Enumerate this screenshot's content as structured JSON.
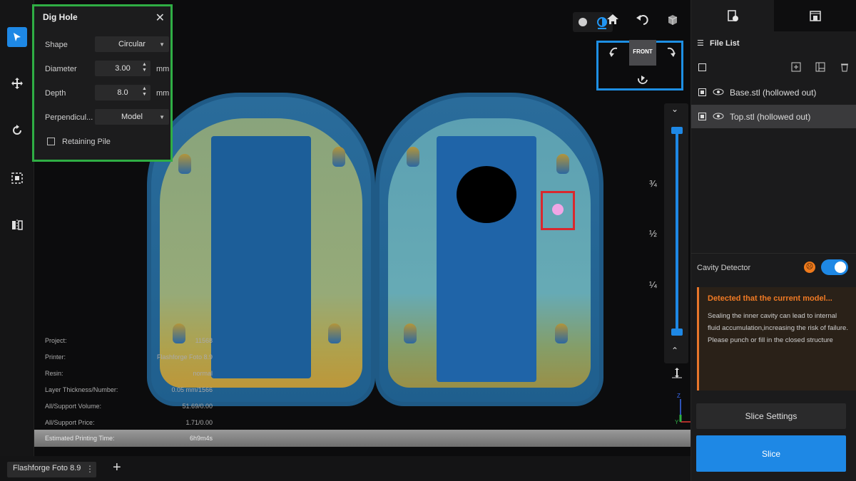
{
  "dig_hole": {
    "title": "Dig Hole",
    "shape_label": "Shape",
    "shape_value": "Circular",
    "diameter_label": "Diameter",
    "diameter_value": "3.00",
    "diameter_unit": "mm",
    "depth_label": "Depth",
    "depth_value": "8.0",
    "depth_unit": "mm",
    "perpendicular_label": "Perpendicul...",
    "perpendicular_value": "Model",
    "retaining_pile_label": "Retaining Pile"
  },
  "view": {
    "front_label": "FRONT",
    "fractions": [
      "¾",
      "½",
      "¼"
    ]
  },
  "info": {
    "rows": [
      {
        "label": "Project:",
        "value": "11568"
      },
      {
        "label": "Printer:",
        "value": "Flashforge Foto 8.9"
      },
      {
        "label": "Resin:",
        "value": "normal"
      },
      {
        "label": "Layer Thickness/Number:",
        "value": "0.05 mm/1566"
      },
      {
        "label": "All/Support Volume:",
        "value": "51.69/0.00"
      },
      {
        "label": "All/Support Price:",
        "value": "1.71/0.00"
      },
      {
        "label": "Estimated Printing Time:",
        "value": "6h9m4s"
      }
    ]
  },
  "gizmo": {
    "z": "Z",
    "y": "Y",
    "x": "X"
  },
  "file_list": {
    "title": "File List",
    "files": [
      {
        "name": "Base.stl (hollowed out)"
      },
      {
        "name": "Top.stl (hollowed out)"
      }
    ]
  },
  "cavity": {
    "label": "Cavity Detector",
    "alert_title": "Detected that the current model...",
    "alert_body": "Sealing the inner cavity can lead to internal fluid accumulation,increasing the risk of failure. Please punch or fill in the closed structure"
  },
  "buttons": {
    "slice_settings": "Slice Settings",
    "slice": "Slice"
  },
  "bottom": {
    "printer_tab": "Flashforge Foto 8.9",
    "add_tab": "+"
  },
  "colors": {
    "accent": "#1e88e5",
    "green_highlight": "#2fae44",
    "red_highlight": "#d9282e",
    "warning": "#f07a24"
  }
}
